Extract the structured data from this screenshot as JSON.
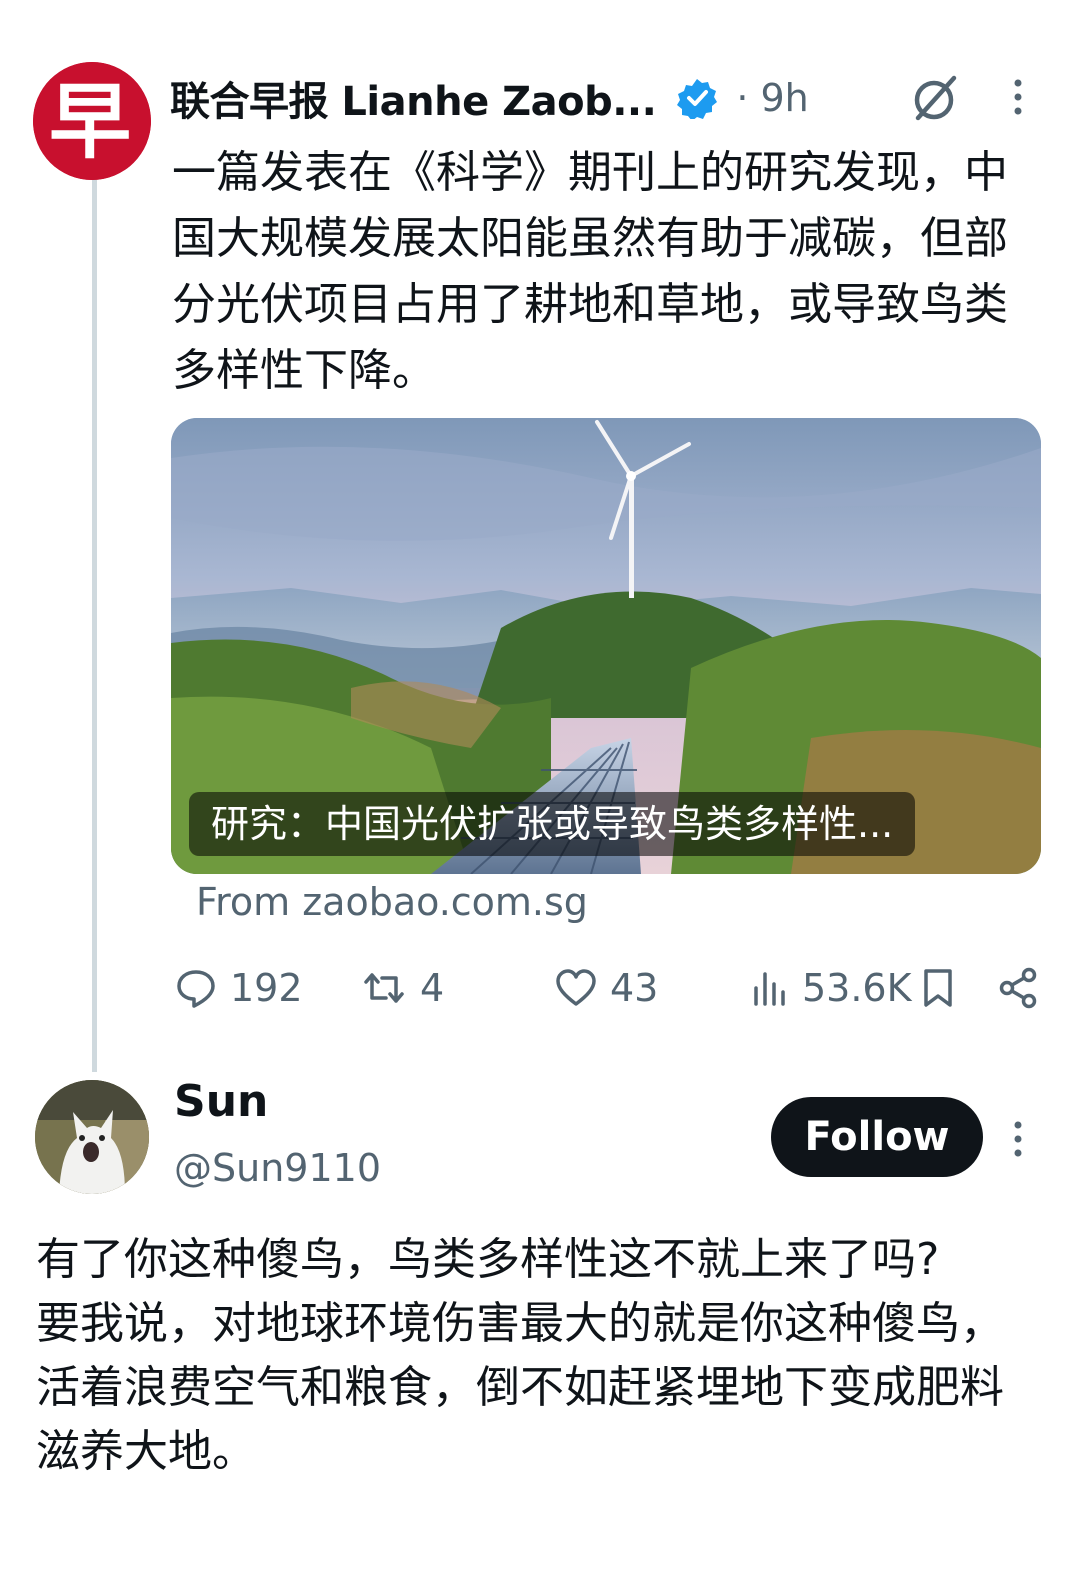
{
  "tweet": {
    "display_name": "联合早报 Lianhe Zaob...",
    "time": "· 9h",
    "avatar_glyph": "早",
    "text": "一篇发表在《科学》期刊上的研究发现，中国大规模发展太阳能虽然有助于减碳，但部分光伏项目占用了耕地和草地，或导致鸟类多样性下降。",
    "card": {
      "title": "研究：中国光伏扩张或导致鸟类多样性...",
      "source": "From zaobao.com.sg"
    },
    "actions": {
      "replies": "192",
      "reposts": "4",
      "likes": "43",
      "views": "53.6K"
    },
    "icons": {
      "verified": "verified-badge-icon",
      "grok": "grok-icon",
      "more": "more-vertical-icon",
      "reply": "reply-icon",
      "repost": "repost-icon",
      "like": "heart-icon",
      "views": "views-chart-icon",
      "bookmark": "bookmark-icon",
      "share": "share-icon"
    }
  },
  "reply": {
    "display_name": "Sun",
    "handle": "@Sun9110",
    "follow_label": "Follow",
    "text": "有了你这种傻鸟，鸟类多样性这不就上来了吗?\n要我说，对地球环境伤害最大的就是你这种傻鸟，活着浪费空气和粮食，倒不如赶紧埋地下变成肥料滋养大地。"
  },
  "colors": {
    "text_primary": "#0f1419",
    "text_secondary": "#536471",
    "verified_blue": "#1d9bf0",
    "brand_red": "#c8102e",
    "thread_line": "#cfd9de"
  }
}
